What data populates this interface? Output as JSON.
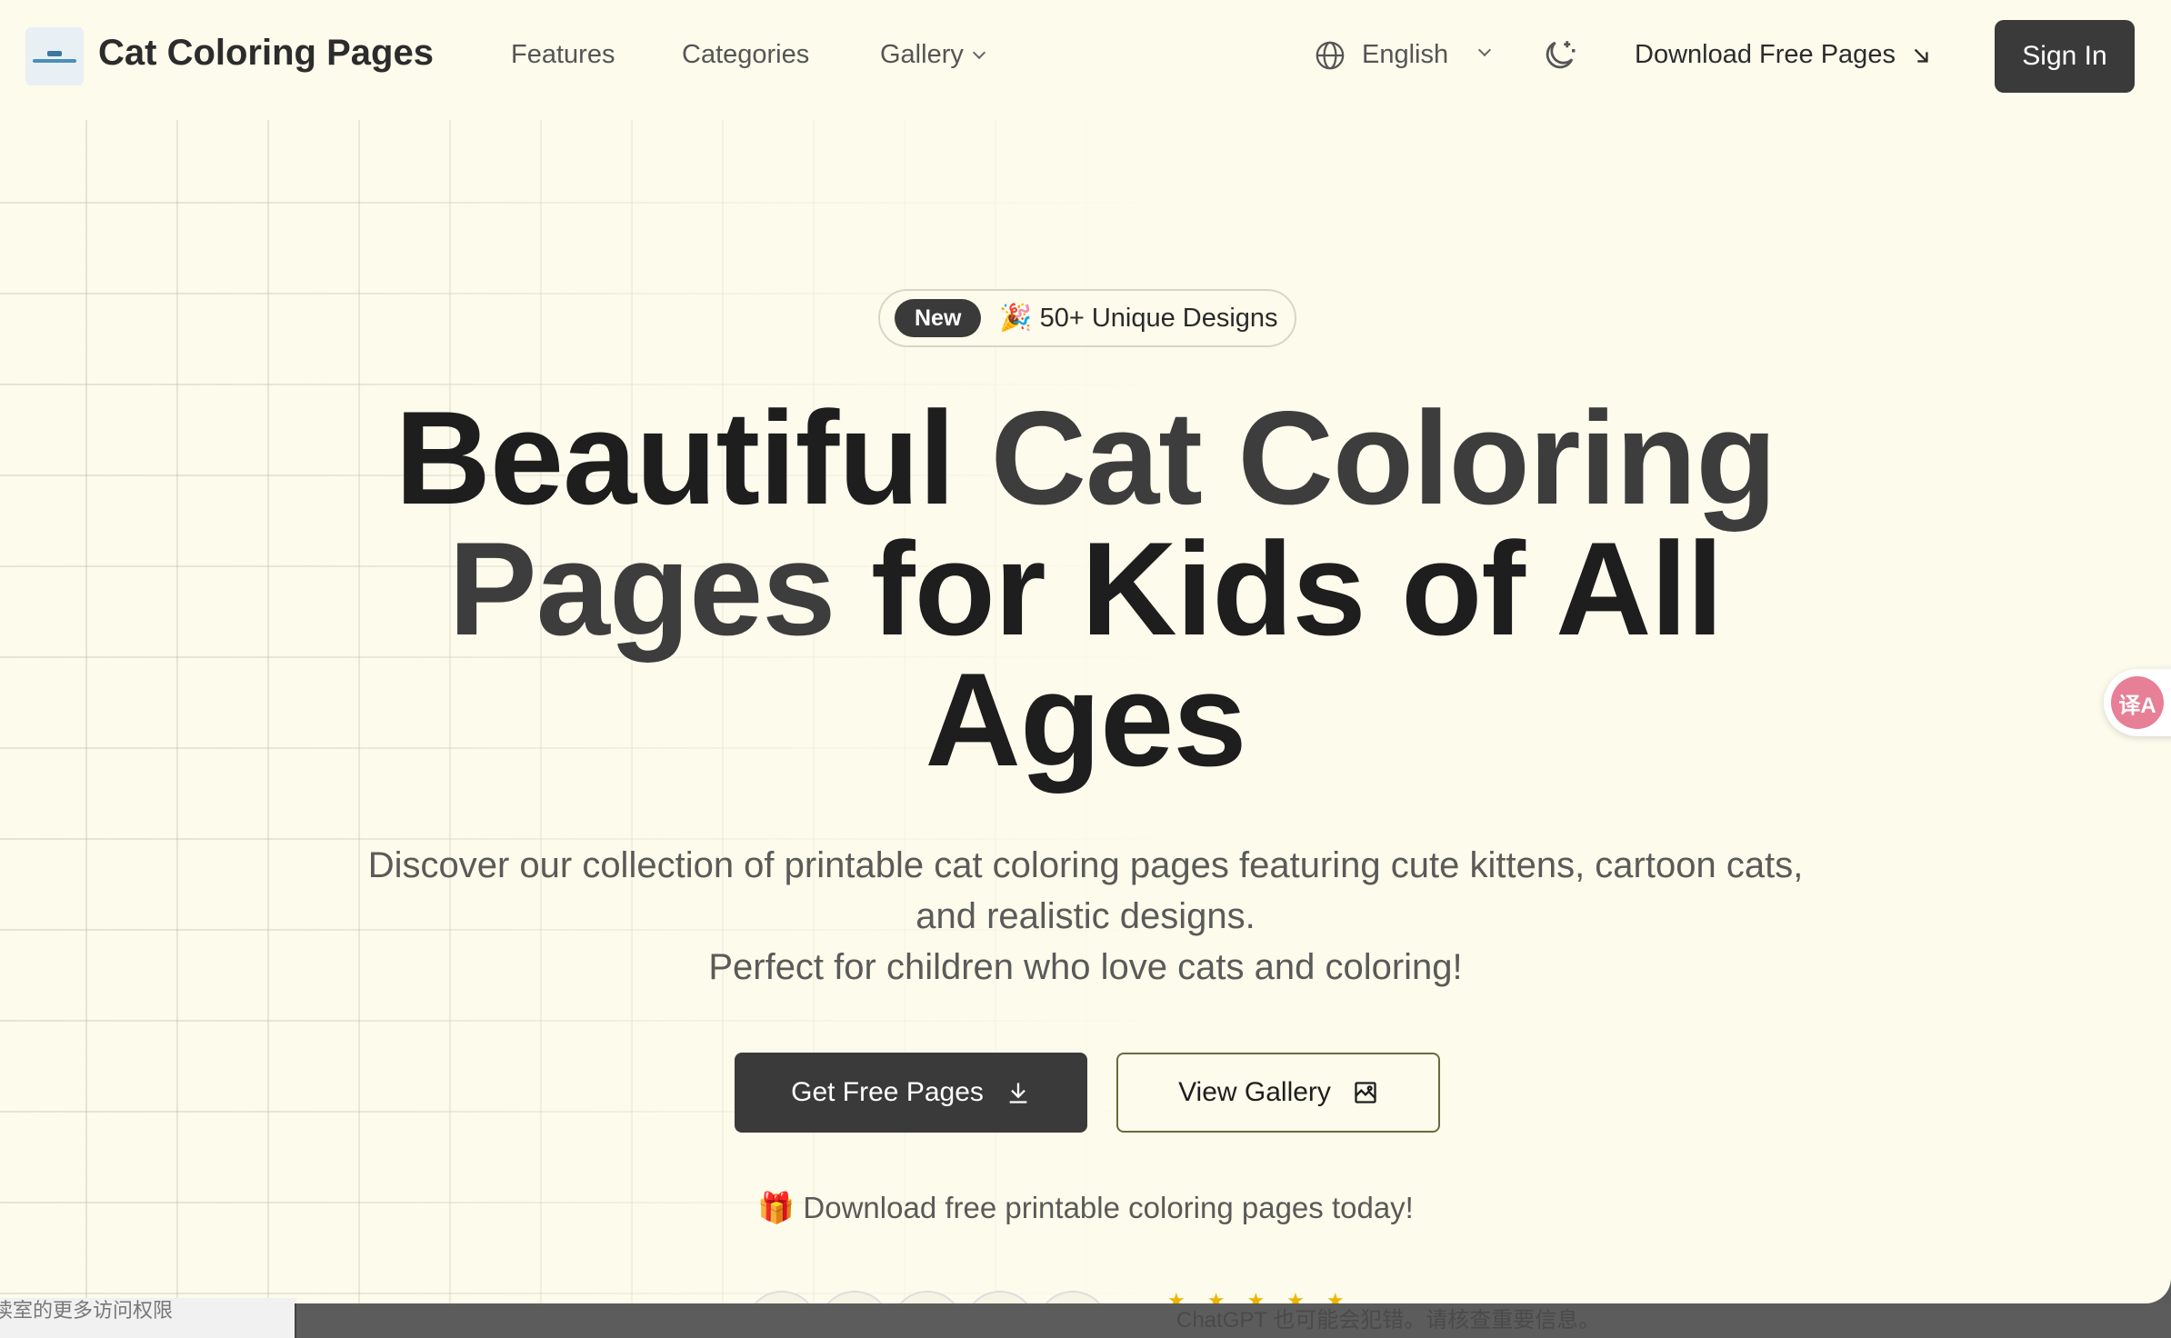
{
  "header": {
    "brand": "Cat Coloring Pages",
    "nav": {
      "features": "Features",
      "categories": "Categories",
      "gallery": "Gallery"
    },
    "language": "English",
    "download_link": "Download Free Pages",
    "sign_in": "Sign In"
  },
  "hero": {
    "badge_new": "New",
    "badge_text": "🎉 50+ Unique Designs",
    "headline": {
      "part1": "Beautiful ",
      "part2": "Cat Coloring Pages",
      "part3": " for Kids of All Ages"
    },
    "subtitle_line1": "Discover our collection of printable cat coloring pages featuring cute kittens, cartoon cats, and realistic designs.",
    "subtitle_line2": "Perfect for children who love cats and coloring!",
    "primary_button": "Get Free Pages",
    "secondary_button": "View Gallery",
    "promo": "🎁 Download free printable coloring pages today!",
    "stars": "★★★★★"
  },
  "overlay": {
    "translate_fab": "译A",
    "bottom_left_text": "读室的更多访问权限",
    "disclaimer": "ChatGPT 也可能会犯错。请核查重要信息。"
  },
  "colors": {
    "page_bg": "#fcfbec",
    "primary": "#3a3a3a",
    "text": "#1e1e1e",
    "muted": "#5a5a58"
  },
  "icons": [
    "globe-icon",
    "chevron-down-icon",
    "moon-stars-icon",
    "arrow-down-right-icon",
    "download-icon",
    "gallery-icon",
    "translate-icon"
  ]
}
